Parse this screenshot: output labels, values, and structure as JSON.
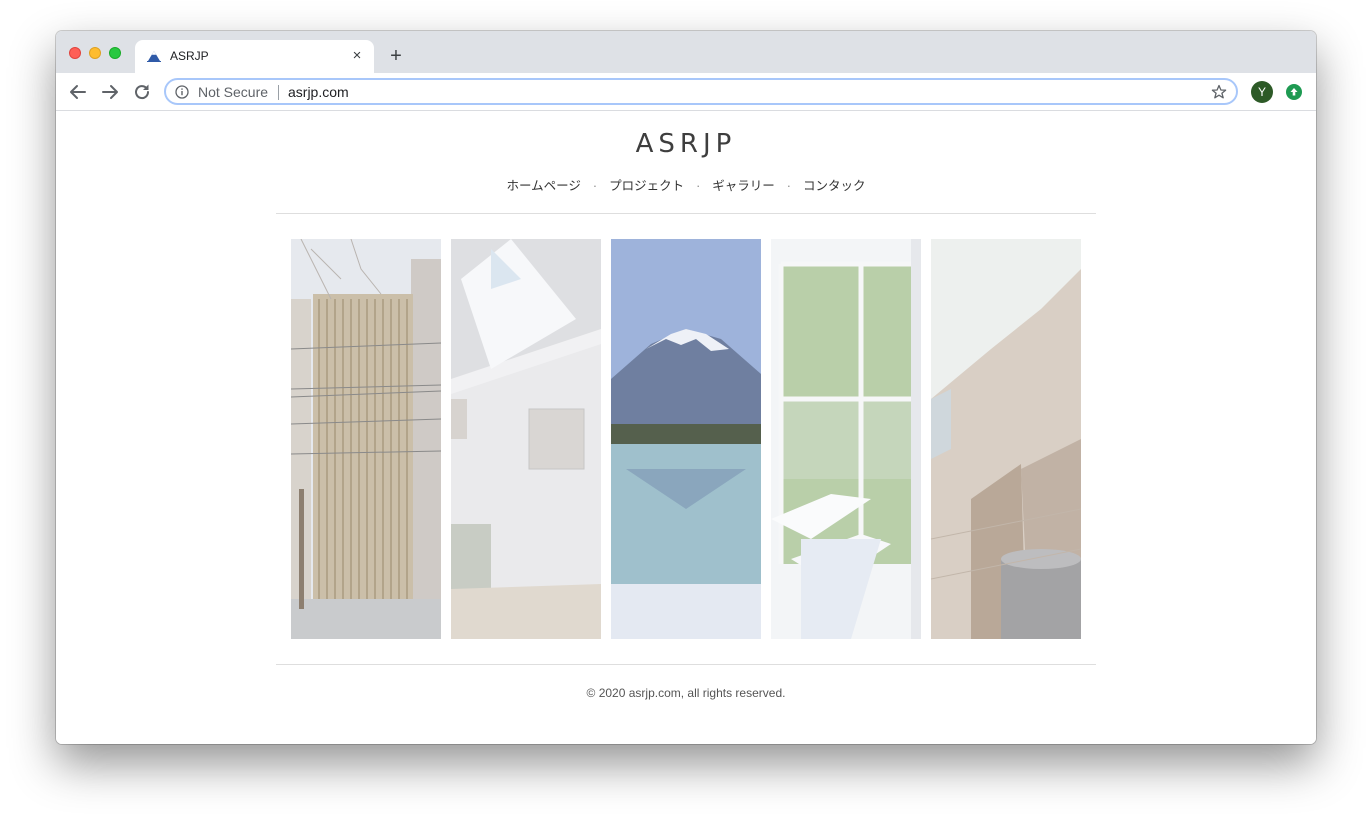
{
  "browser": {
    "tab": {
      "title": "ASRJP",
      "close_label": "×"
    },
    "new_tab_label": "+",
    "address_bar": {
      "security_label": "Not Secure",
      "url": "asrjp.com"
    },
    "profile_initial": "Y"
  },
  "site": {
    "title": "ASRJP",
    "nav": [
      {
        "label": "ホームページ"
      },
      {
        "label": "プロジェクト"
      },
      {
        "label": "ギャラリー"
      },
      {
        "label": "コンタック"
      }
    ],
    "nav_separator": "·",
    "gallery": [
      {
        "name": "slatted-building-photo"
      },
      {
        "name": "skylight-interior-photo"
      },
      {
        "name": "mount-fuji-photo"
      },
      {
        "name": "spiral-staircase-photo"
      },
      {
        "name": "concrete-building-photo"
      }
    ],
    "footer": "© 2020 asrjp.com, all rights reserved."
  },
  "colors": {
    "tabstrip": "#dee1e6",
    "omnibox_focus": "#a8c7fa",
    "avatar": "#2d5a27",
    "extension": "#1e9a52"
  }
}
